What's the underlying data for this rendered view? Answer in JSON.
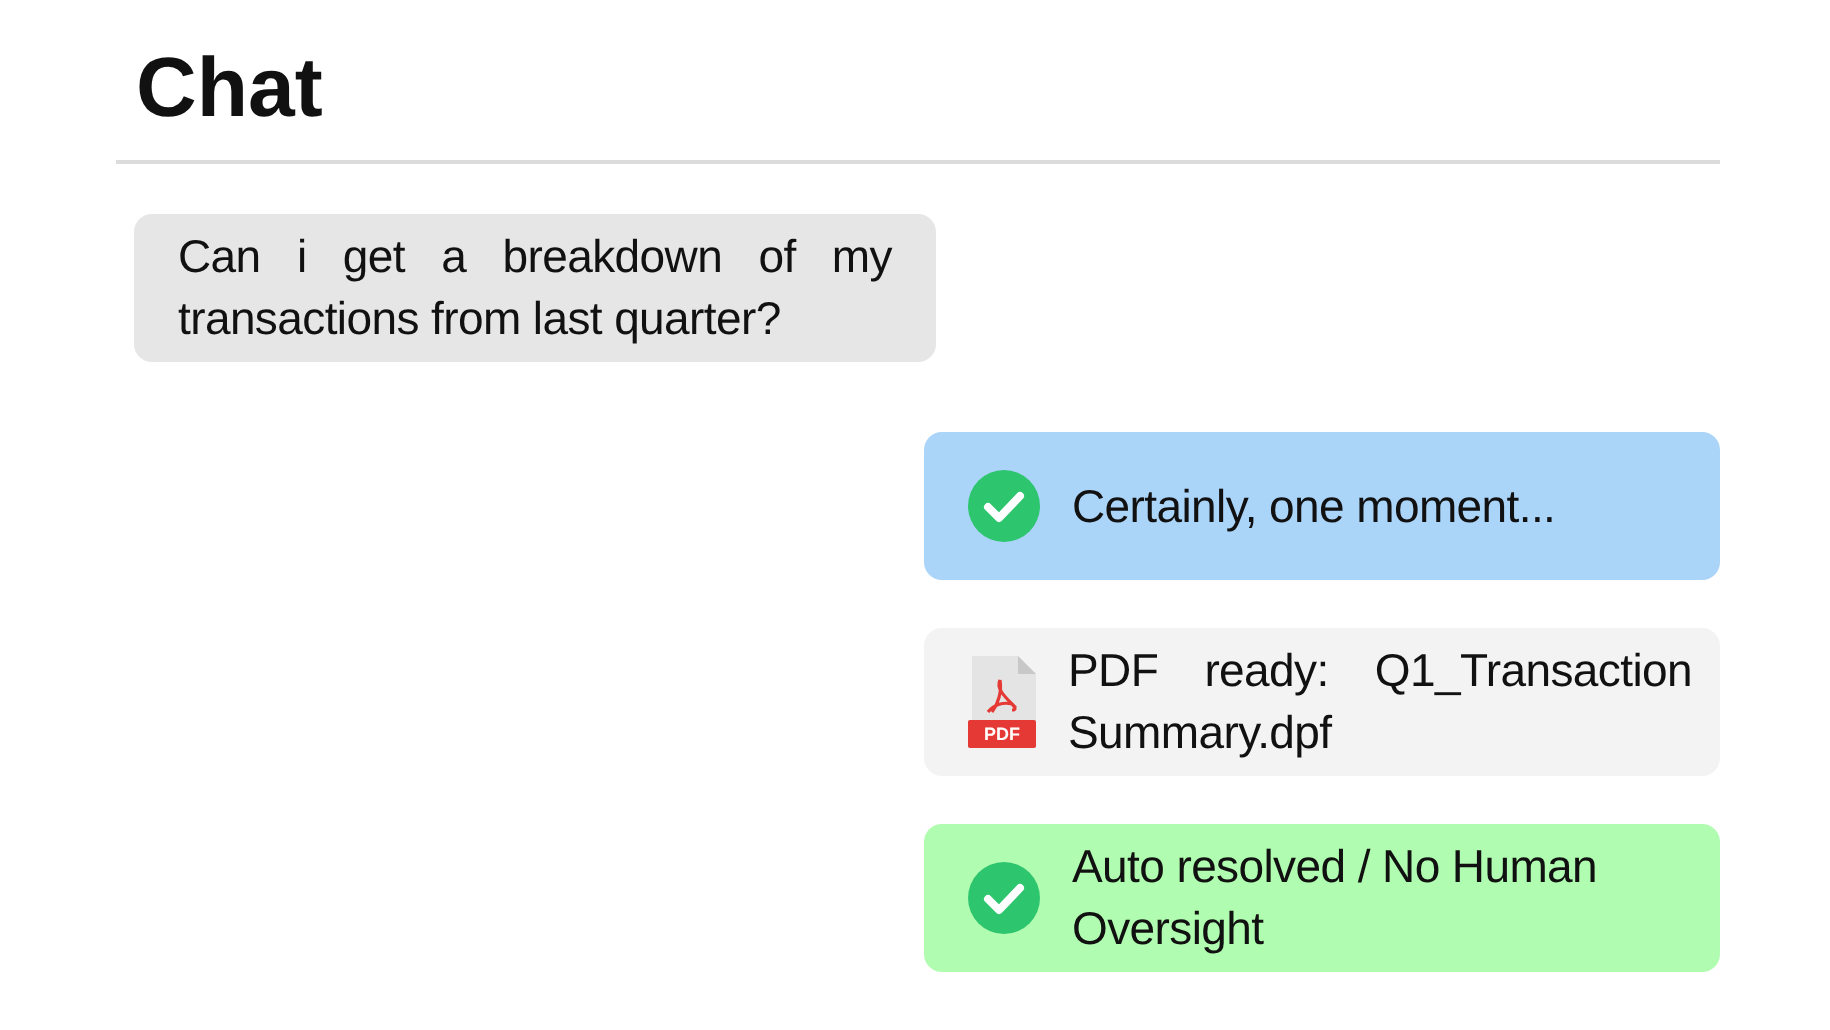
{
  "title": "Chat",
  "messages": [
    {
      "kind": "user",
      "text": "Can i get a breakdown of my transactions from last quarter?",
      "color": "#e6e6e6"
    },
    {
      "kind": "status",
      "text": "Certainly, one moment...",
      "color": "#aad4f8"
    },
    {
      "kind": "file",
      "icon_label": "PDF",
      "text": "PDF ready: Q1_Transaction Summary.dpf",
      "color": "#f3f3f3"
    },
    {
      "kind": "status",
      "text": "Auto resolved / No Human Oversight",
      "color": "#b0fcb0"
    }
  ]
}
